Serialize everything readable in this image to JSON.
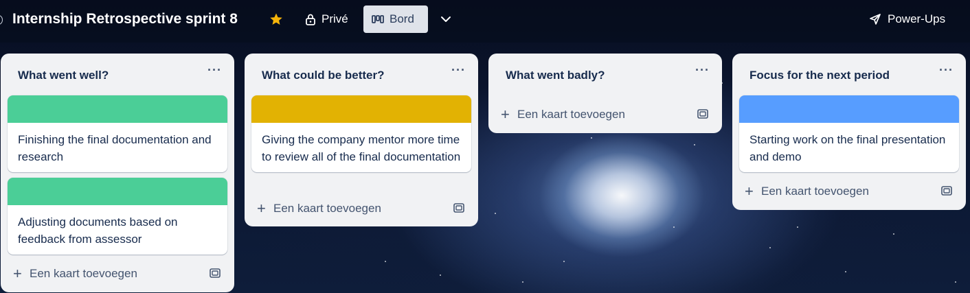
{
  "header": {
    "title": "Internship Retrospective sprint 8",
    "star_icon": "star-icon",
    "visibility_label": "Privé",
    "view_label": "Bord",
    "powerups_label": "Power-Ups",
    "star_color": "#f5b40a"
  },
  "lists": [
    {
      "title": "What went well?",
      "menu": "···",
      "cards": [
        {
          "cover": "#4bce97",
          "text": "Finishing the final documentation and research"
        },
        {
          "cover": "#4bce97",
          "text": "Adjusting documents based on feedback from assessor"
        }
      ],
      "add_label": "Een kaart toevoegen"
    },
    {
      "title": "What could be better?",
      "menu": "···",
      "cards": [
        {
          "cover": "#e2b203",
          "text": "Giving the company mentor more time to review all of the final documentation"
        }
      ],
      "add_label": "Een kaart toevoegen"
    },
    {
      "title": "What went badly?",
      "menu": "···",
      "cards": [],
      "add_label": "Een kaart toevoegen"
    },
    {
      "title": "Focus for the next period",
      "menu": "···",
      "cards": [
        {
          "cover": "#579dff",
          "text": "Starting work on the final presentation and demo"
        }
      ],
      "add_label": "Een kaart toevoegen"
    }
  ]
}
